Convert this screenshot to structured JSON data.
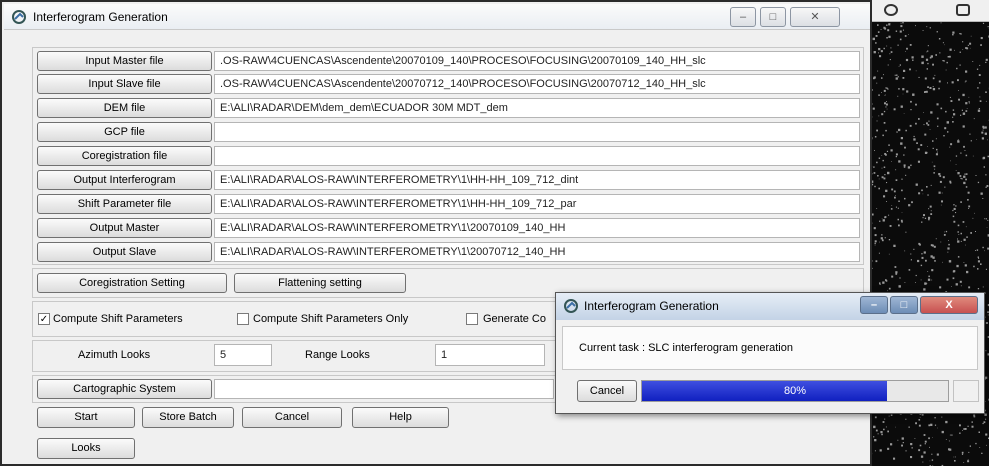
{
  "window": {
    "title": "Interferogram Generation",
    "controls": [
      "–",
      "□",
      "✕"
    ]
  },
  "files": [
    {
      "button": "Input Master file",
      "value": ".OS-RAW\\4CUENCAS\\Ascendente\\20070109_140\\PROCESO\\FOCUSING\\20070109_140_HH_slc"
    },
    {
      "button": "Input Slave file",
      "value": ".OS-RAW\\4CUENCAS\\Ascendente\\20070712_140\\PROCESO\\FOCUSING\\20070712_140_HH_slc"
    },
    {
      "button": "DEM file",
      "value": "E:\\ALI\\RADAR\\DEM\\dem_dem\\ECUADOR 30M MDT_dem"
    },
    {
      "button": "GCP file",
      "value": ""
    },
    {
      "button": "Coregistration file",
      "value": ""
    },
    {
      "button": "Output Interferogram",
      "value": "E:\\ALI\\RADAR\\ALOS-RAW\\INTERFEROMETRY\\1\\HH-HH_109_712_dint"
    },
    {
      "button": "Shift Parameter file",
      "value": "E:\\ALI\\RADAR\\ALOS-RAW\\INTERFEROMETRY\\1\\HH-HH_109_712_par"
    },
    {
      "button": "Output Master",
      "value": "E:\\ALI\\RADAR\\ALOS-RAW\\INTERFEROMETRY\\1\\20070109_140_HH"
    },
    {
      "button": "Output Slave",
      "value": "E:\\ALI\\RADAR\\ALOS-RAW\\INTERFEROMETRY\\1\\20070712_140_HH"
    }
  ],
  "settings": {
    "coregistration": "Coregistration Setting",
    "flattening": "Flattening setting"
  },
  "options": {
    "compute_shift": {
      "label": "Compute Shift Parameters",
      "checked": true,
      "mark": "✓"
    },
    "compute_shift_only": {
      "label": "Compute Shift Parameters Only",
      "checked": false
    },
    "generate": {
      "label": "Generate Co",
      "checked": false
    }
  },
  "looks": {
    "azimuth_label": "Azimuth Looks",
    "azimuth_value": "5",
    "range_label": "Range Looks",
    "range_value": "1"
  },
  "cartographic": "Cartographic System",
  "actions": {
    "start": "Start",
    "store_batch": "Store Batch",
    "cancel": "Cancel",
    "help": "Help",
    "looks": "Looks"
  },
  "progress_dialog": {
    "title": "Interferogram Generation",
    "task": "Current task : SLC interferogram generation",
    "cancel": "Cancel",
    "percent_label": "80%",
    "progress": 0.8,
    "controls": [
      "–",
      "□",
      "X"
    ]
  },
  "colors": {
    "progress_fill": "#1020c0",
    "close_red": "#c75050"
  }
}
